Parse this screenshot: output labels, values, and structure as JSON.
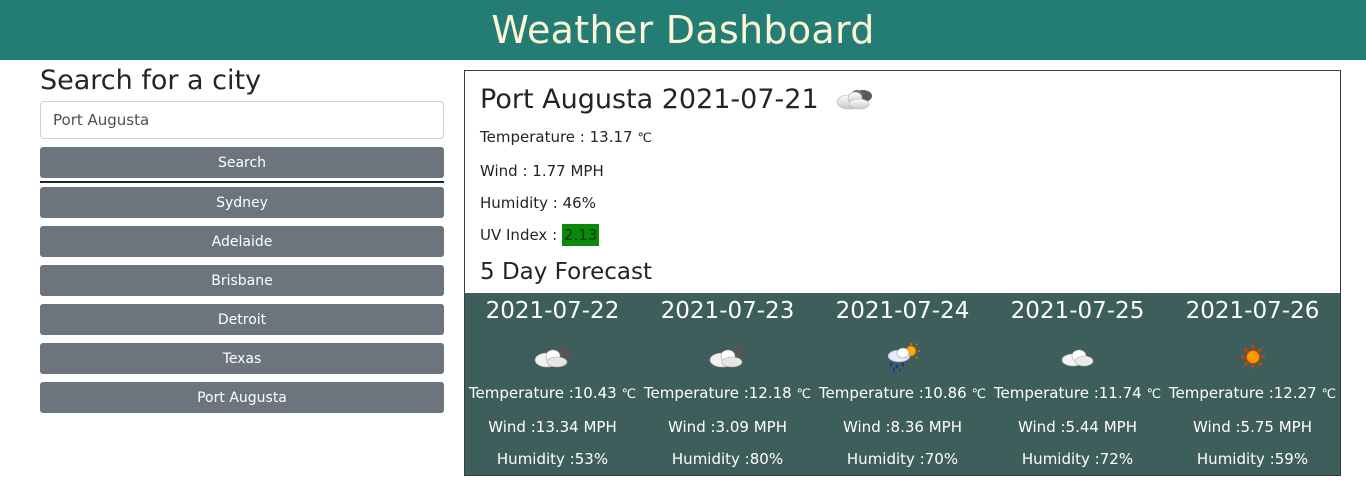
{
  "header": {
    "title": "Weather Dashboard"
  },
  "sidebar": {
    "heading": "Search for a city",
    "search_value": "Port Augusta",
    "search_button": "Search",
    "history": [
      "Sydney",
      "Adelaide",
      "Brisbane",
      "Detroit",
      "Texas",
      "Port Augusta"
    ]
  },
  "current": {
    "city_date": "Port Augusta 2021-07-21",
    "icon": "cloud-icon",
    "temperature_label": "Temperature : ",
    "temperature_value": "13.17",
    "temperature_unit": "℃",
    "wind": "Wind : 1.77 MPH",
    "humidity": "Humidity : 46%",
    "uv_label": "UV Index : ",
    "uv_value": "2.13",
    "uv_color": "#0a8a0a"
  },
  "forecast": {
    "title": "5 Day Forecast",
    "days": [
      {
        "date": "2021-07-22",
        "icon": "cloud-icon",
        "temp": "Temperature :10.43 ",
        "unit": "℃",
        "wind": "Wind :13.34 MPH",
        "humidity": "Humidity :53%"
      },
      {
        "date": "2021-07-23",
        "icon": "cloud-icon",
        "temp": "Temperature :12.18 ",
        "unit": "℃",
        "wind": "Wind :3.09 MPH",
        "humidity": "Humidity :80%"
      },
      {
        "date": "2021-07-24",
        "icon": "rain-sun-icon",
        "temp": "Temperature :10.86 ",
        "unit": "℃",
        "wind": "Wind :8.36 MPH",
        "humidity": "Humidity :70%"
      },
      {
        "date": "2021-07-25",
        "icon": "light-cloud-icon",
        "temp": "Temperature :11.74 ",
        "unit": "℃",
        "wind": "Wind :5.44 MPH",
        "humidity": "Humidity :72%"
      },
      {
        "date": "2021-07-26",
        "icon": "sun-icon",
        "temp": "Temperature :12.27 ",
        "unit": "℃",
        "wind": "Wind :5.75 MPH",
        "humidity": "Humidity :59%"
      }
    ]
  },
  "colors": {
    "header_bg": "#237d74",
    "header_text": "#fdf5d6",
    "button_bg": "#6c757d",
    "forecast_bg": "#3d5e5a"
  }
}
